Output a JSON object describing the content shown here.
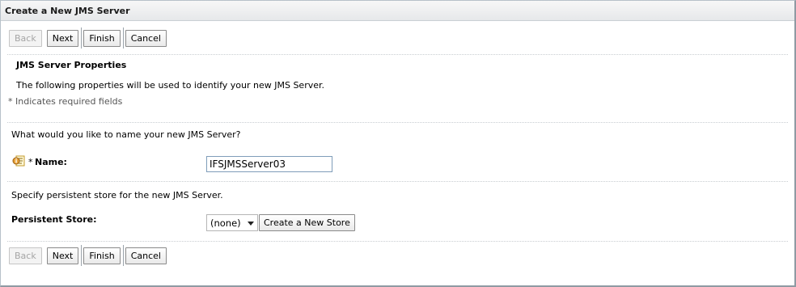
{
  "window": {
    "title": "Create a New JMS Server"
  },
  "buttons": {
    "back": "Back",
    "next": "Next",
    "finish": "Finish",
    "cancel": "Cancel"
  },
  "section": {
    "title": "JMS Server Properties",
    "description": "The following properties will be used to identify your new JMS Server.",
    "required_note": "* Indicates required fields"
  },
  "name_section": {
    "question": "What would you like to name your new JMS Server?",
    "required_marker": "*",
    "label": "Name:",
    "value": "IFSJMSServer03"
  },
  "store_section": {
    "description": "Specify persistent store for the new JMS Server.",
    "label": "Persistent Store:",
    "selected": "(none)",
    "create_button": "Create a New Store"
  }
}
